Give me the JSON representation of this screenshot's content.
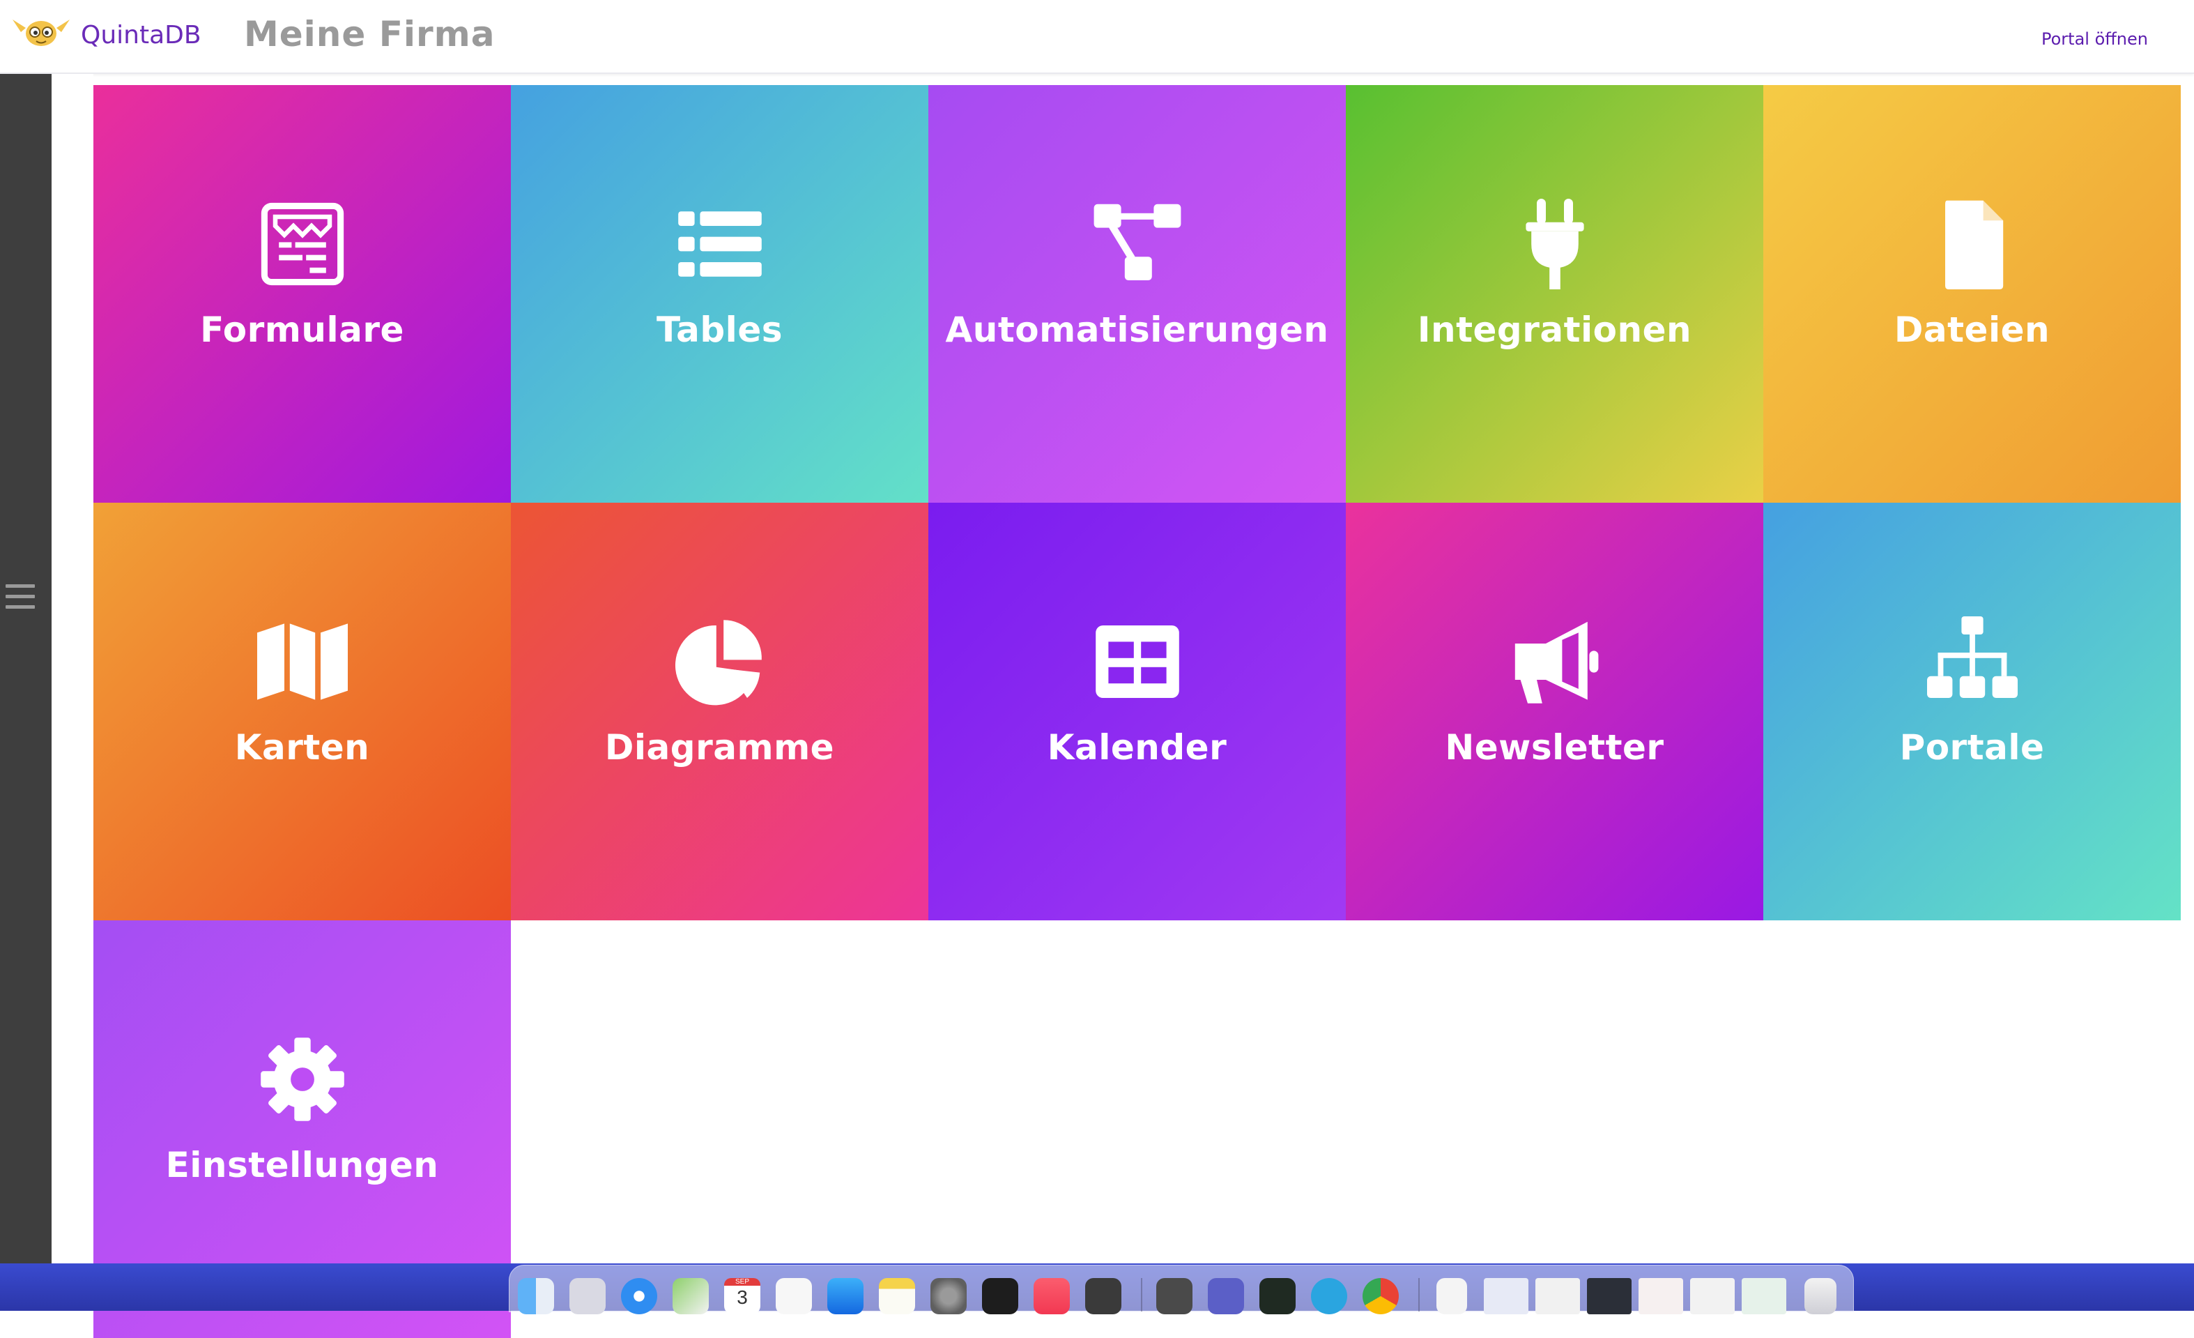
{
  "header": {
    "brand": "QuintaDB",
    "company": "Meine Firma",
    "portal_link": "Portal öffnen"
  },
  "colors": {
    "brand": "#6a2bb8",
    "sidebar": "#3e3e3e",
    "company": "#9a9a9a"
  },
  "tiles": [
    {
      "label": "Formulare",
      "icon": "form-icon"
    },
    {
      "label": "Tables",
      "icon": "list-icon"
    },
    {
      "label": "Automatisierungen",
      "icon": "workflow-icon"
    },
    {
      "label": "Integrationen",
      "icon": "plug-icon"
    },
    {
      "label": "Dateien",
      "icon": "file-icon"
    },
    {
      "label": "Karten",
      "icon": "map-icon"
    },
    {
      "label": "Diagramme",
      "icon": "pie-chart-icon"
    },
    {
      "label": "Kalender",
      "icon": "calendar-grid-icon"
    },
    {
      "label": "Newsletter",
      "icon": "megaphone-icon"
    },
    {
      "label": "Portale",
      "icon": "sitemap-icon"
    },
    {
      "label": "Einstellungen",
      "icon": "gear-icon"
    }
  ],
  "dock": {
    "apps": [
      "finder-icon",
      "launchpad-icon",
      "safari-icon",
      "maps-icon",
      "calendar-icon",
      "reminders-icon",
      "app-store-icon",
      "notes-icon",
      "system-settings-icon",
      "terminal-icon",
      "music-icon",
      "calculator-icon",
      "sublime-text-icon",
      "teams-icon",
      "activity-monitor-icon",
      "telegram-icon",
      "chrome-icon",
      "document-icon",
      "window-thumbnail-icon",
      "trash-icon"
    ],
    "calendar_month": "SEP",
    "calendar_day": "3"
  }
}
